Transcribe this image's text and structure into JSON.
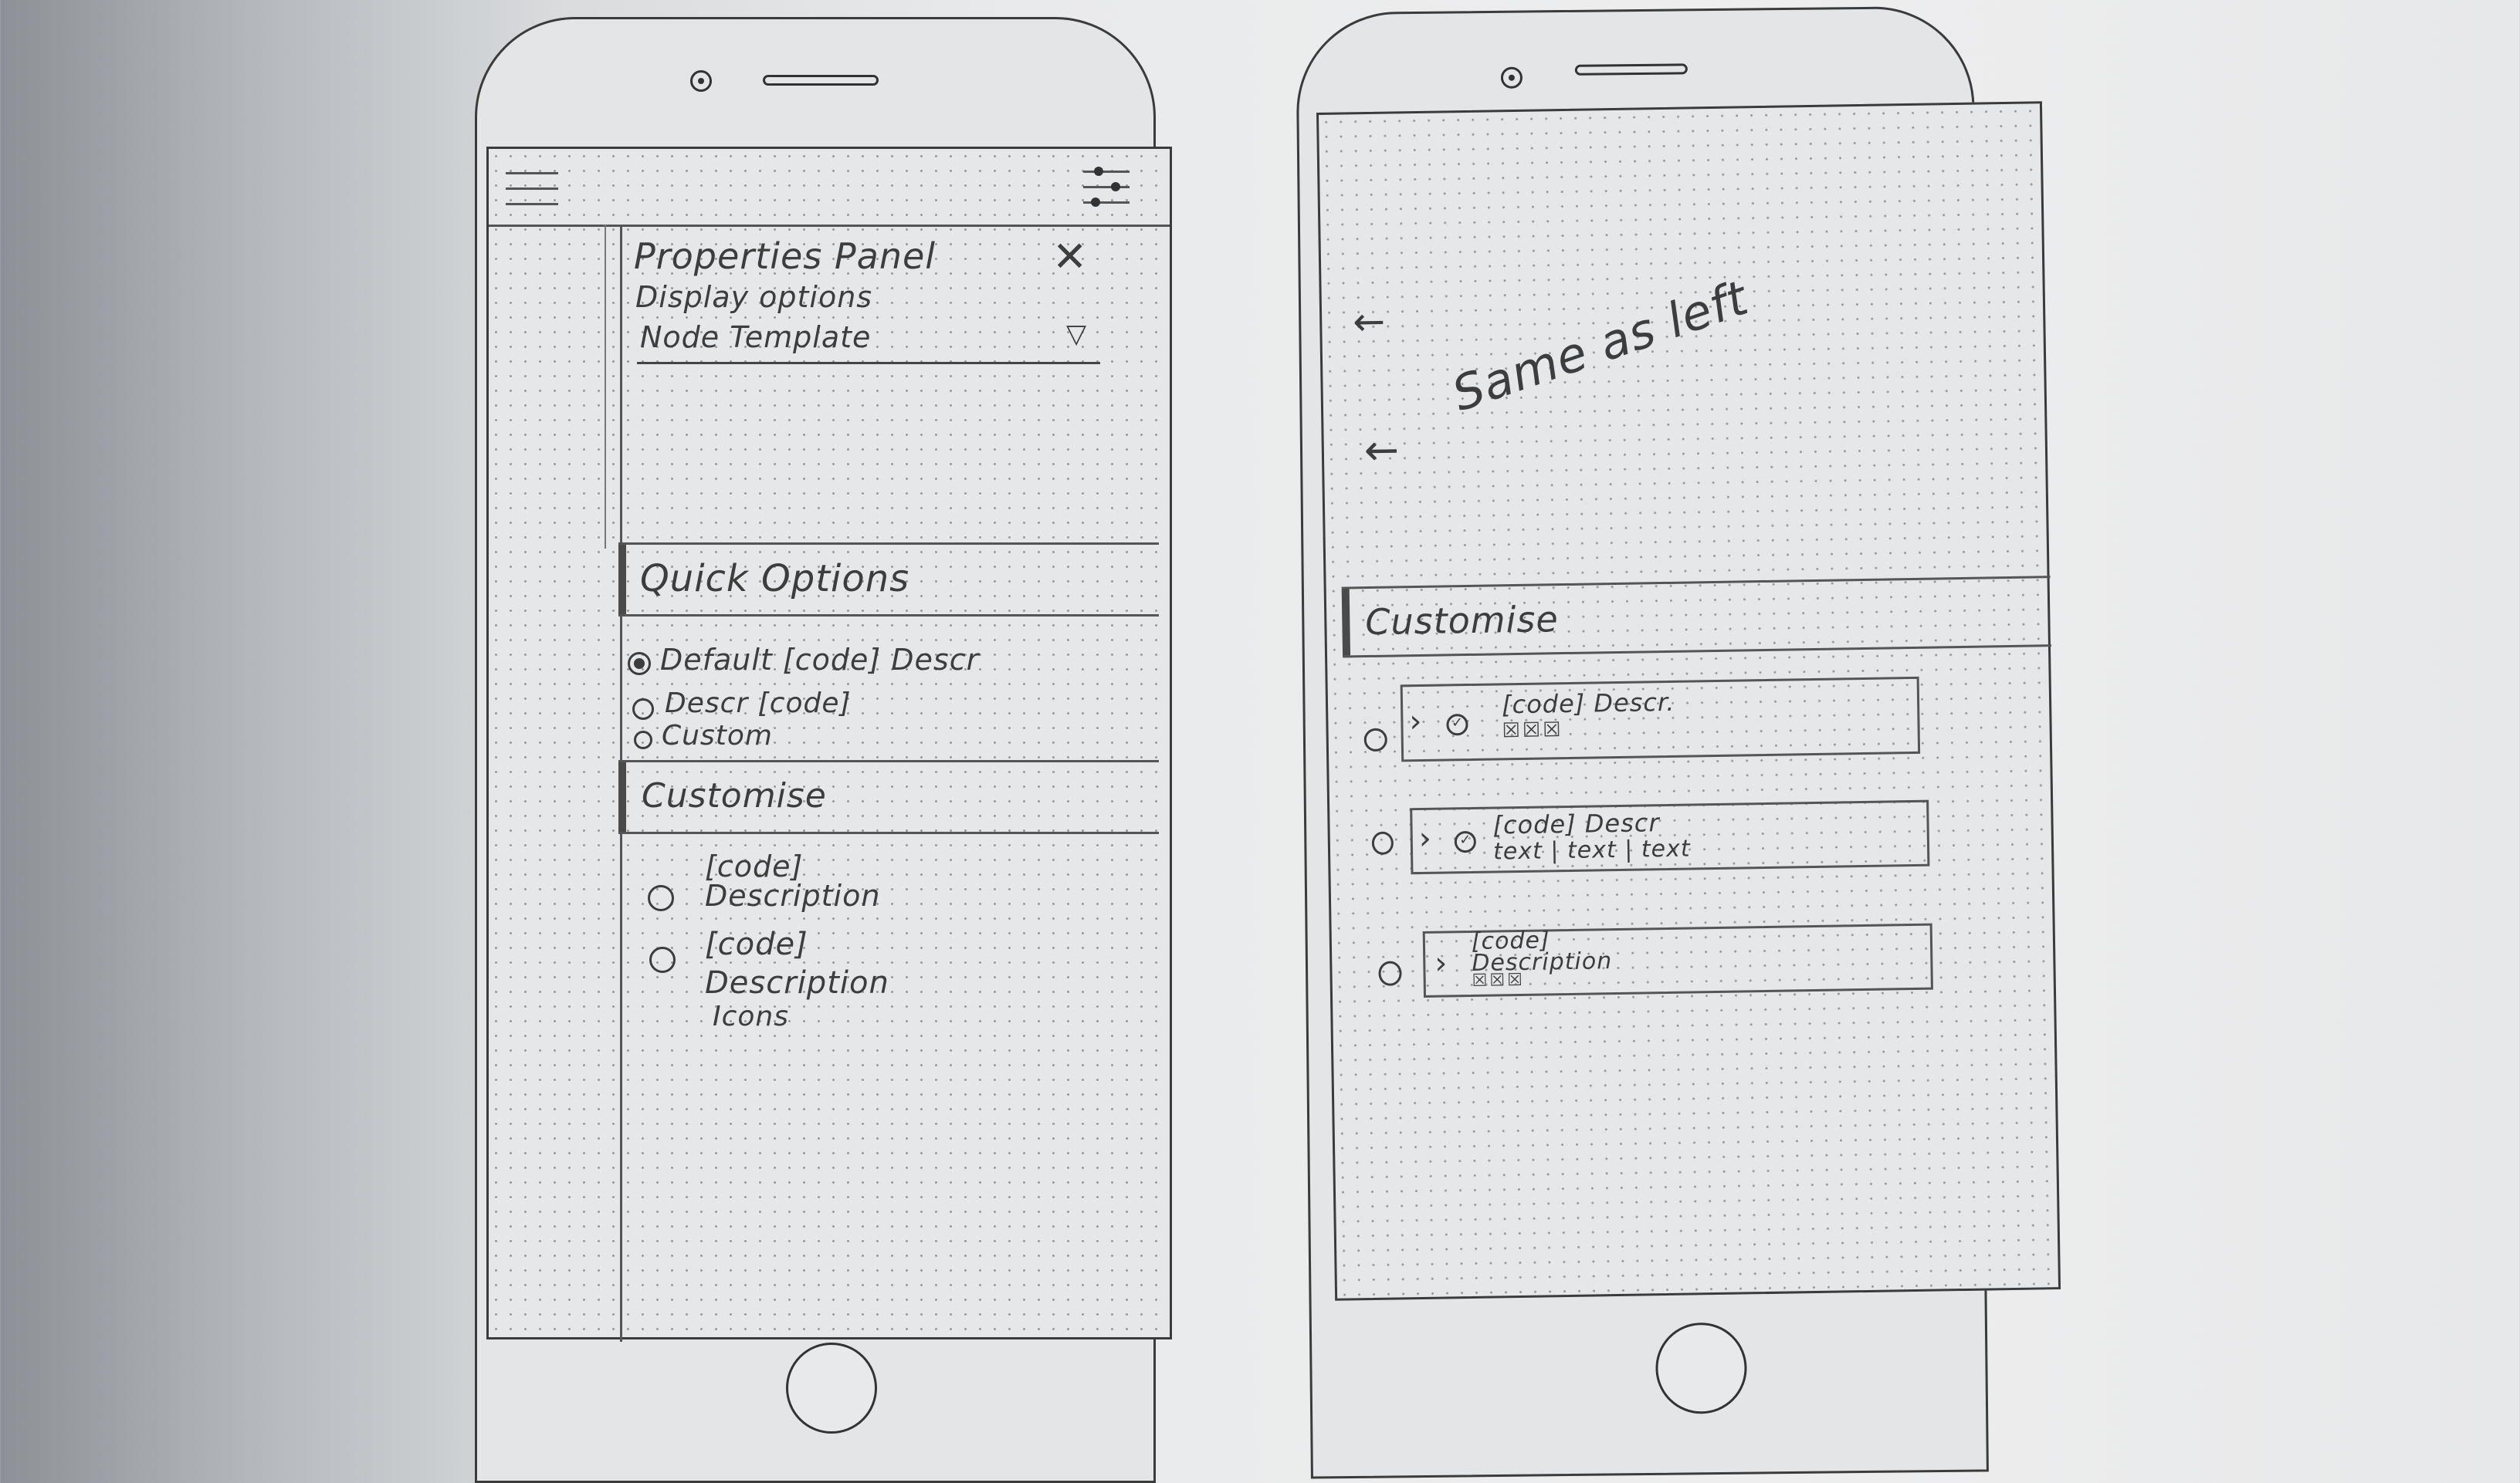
{
  "left_phone": {
    "panel": {
      "title": "Properties Panel",
      "subtitle": "Display options",
      "dropdown_label": "Node Template",
      "dropdown_icon": "triangle-down-icon",
      "close_icon": "x-icon"
    },
    "header_icons": {
      "menu": "hamburger-icon",
      "settings": "sliders-icon"
    },
    "quick_options": {
      "heading": "Quick Options",
      "options": [
        {
          "label": "Default [code] Descr",
          "selected": true
        },
        {
          "label": "Descr [code]",
          "selected": false
        },
        {
          "label": "Custom",
          "selected": false
        }
      ]
    },
    "customise": {
      "heading": "Customise",
      "options": [
        {
          "lines": [
            "[code]",
            "Description"
          ]
        },
        {
          "lines": [
            "[code]",
            "Description",
            "Icons"
          ]
        }
      ]
    }
  },
  "right_phone": {
    "annotation": "Same as left",
    "customise": {
      "heading": "Customise",
      "items": [
        {
          "line1": "[code] Descr.",
          "line2_icons": "☒☒☒"
        },
        {
          "line1": "[code] Descr",
          "line2": "text | text | text"
        },
        {
          "line1": "[code]",
          "line2": "Description",
          "line3_icons": "☒☒☒"
        }
      ]
    }
  }
}
